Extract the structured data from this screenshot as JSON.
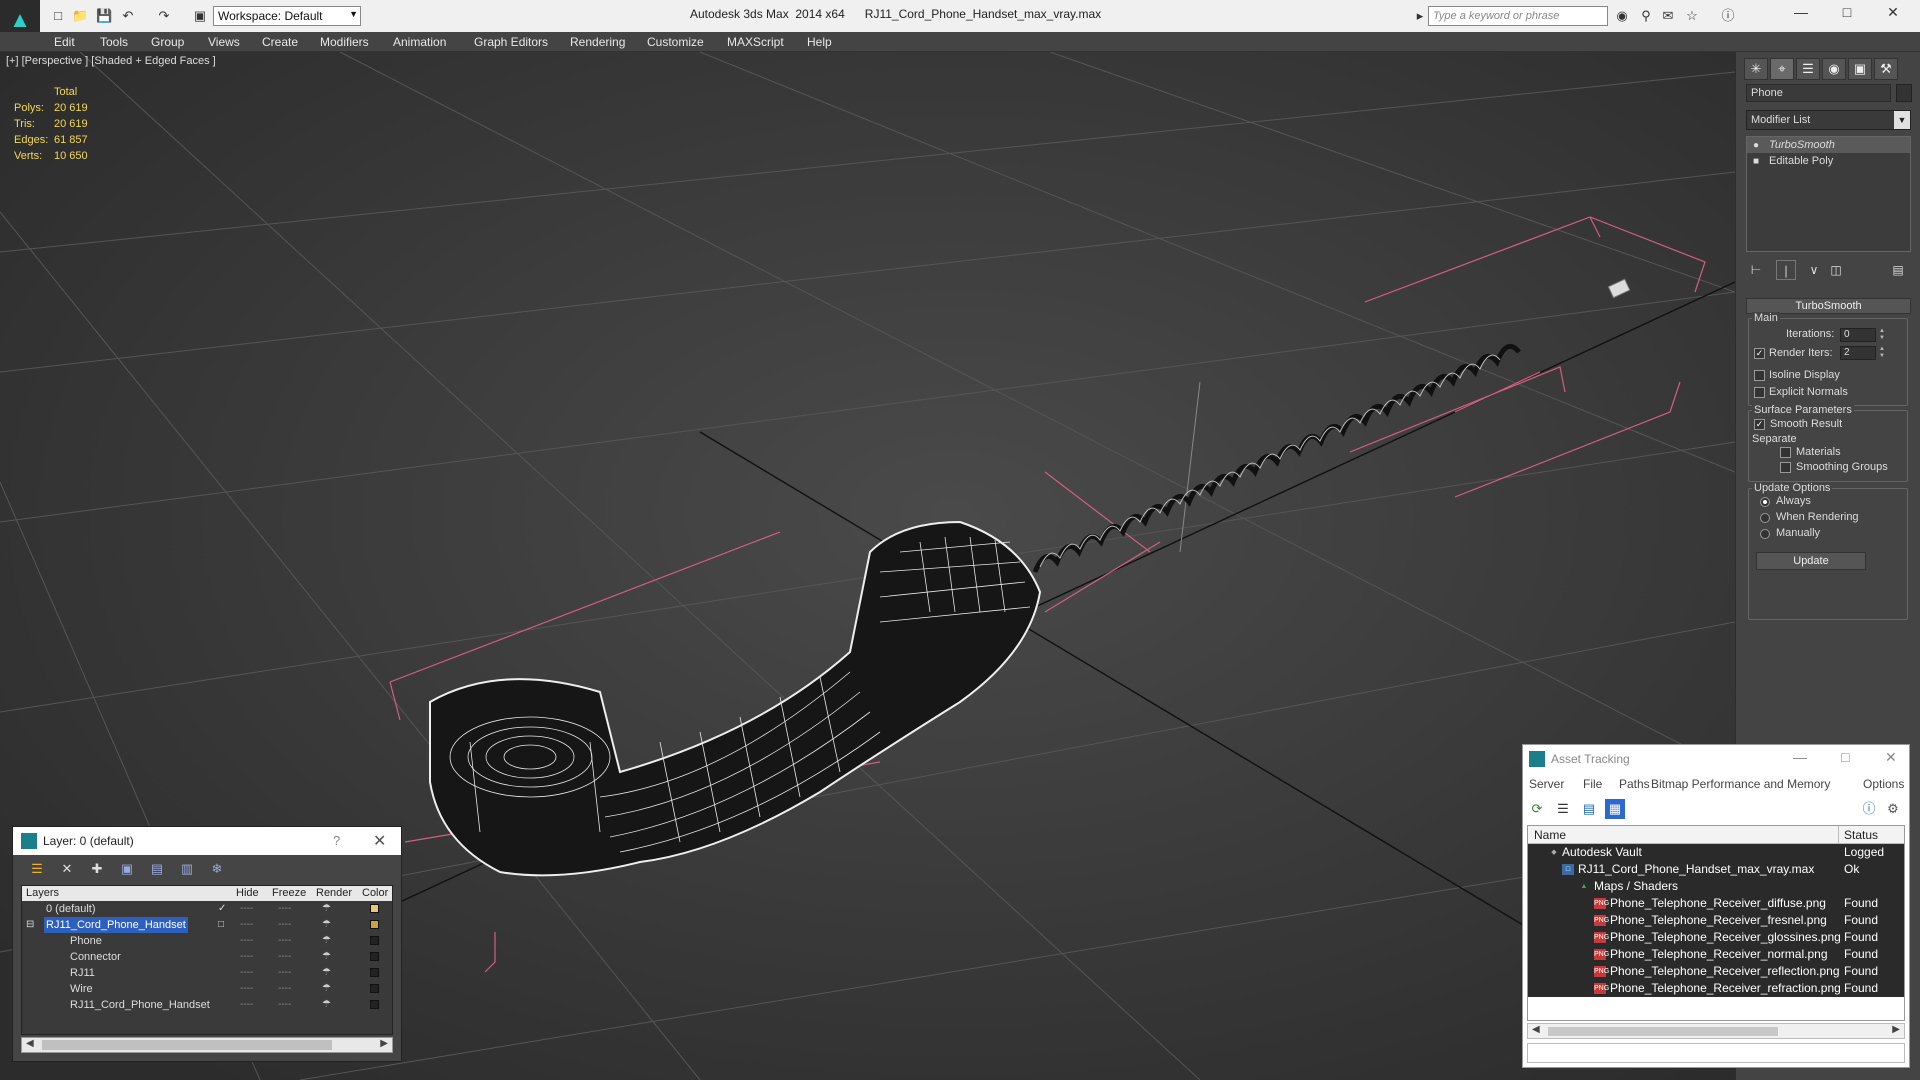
{
  "titlebar": {
    "workspace": "Workspace: Default",
    "app_name": "Autodesk 3ds Max  2014 x64",
    "file_name": "RJ11_Cord_Phone_Handset_max_vray.max",
    "search_placeholder": "Type a keyword or phrase"
  },
  "menu": [
    "Edit",
    "Tools",
    "Group",
    "Views",
    "Create",
    "Modifiers",
    "Animation",
    "Graph Editors",
    "Rendering",
    "Customize",
    "MAXScript",
    "Help"
  ],
  "viewport": {
    "label": "[+] [Perspective ] [Shaded + Edged Faces ]",
    "stats": {
      "header": "Total",
      "rows": [
        {
          "label": "Polys:",
          "value": "20 619"
        },
        {
          "label": "Tris:",
          "value": "20 619"
        },
        {
          "label": "Edges:",
          "value": "61 857"
        },
        {
          "label": "Verts:",
          "value": "10 650"
        }
      ]
    }
  },
  "command_panel": {
    "object_name": "Phone",
    "modifier_list": "Modifier List",
    "stack": [
      "TurboSmooth",
      "Editable Poly"
    ],
    "rollout": "TurboSmooth",
    "main_group": "Main",
    "iterations_label": "Iterations:",
    "iterations_value": "0",
    "render_iters_label": "Render Iters:",
    "render_iters_value": "2",
    "isoline": "Isoline Display",
    "explicit_normals": "Explicit Normals",
    "surface_group": "Surface Parameters",
    "smooth_result": "Smooth Result",
    "separate": "Separate",
    "materials": "Materials",
    "smoothing_groups": "Smoothing Groups",
    "update_group": "Update Options",
    "always": "Always",
    "when_rendering": "When Rendering",
    "manually": "Manually",
    "update_button": "Update"
  },
  "layer_dialog": {
    "title": "Layer: 0 (default)",
    "help": "?",
    "columns": [
      "Layers",
      "Hide",
      "Freeze",
      "Render",
      "Color"
    ],
    "rows": [
      {
        "name": "0 (default)",
        "indent": 0,
        "color": "#e8c77a"
      },
      {
        "name": "RJ11_Cord_Phone_Handset",
        "indent": 0,
        "color": "#c9a542"
      },
      {
        "name": "Phone",
        "indent": 1,
        "color": "#222222"
      },
      {
        "name": "Connector",
        "indent": 1,
        "color": "#222222"
      },
      {
        "name": "RJ11",
        "indent": 1,
        "color": "#222222"
      },
      {
        "name": "Wire",
        "indent": 1,
        "color": "#222222"
      },
      {
        "name": "RJ11_Cord_Phone_Handset",
        "indent": 1,
        "color": "#222222"
      }
    ],
    "cell_mark": "----"
  },
  "asset_dialog": {
    "title": "Asset Tracking",
    "menu": [
      "Server",
      "File",
      "Paths",
      "Bitmap Performance and Memory",
      "Options"
    ],
    "col_name": "Name",
    "col_status": "Status",
    "rows": [
      {
        "name": "Autodesk Vault",
        "status": "Logged Out",
        "indent": 0,
        "icon": "vault"
      },
      {
        "name": "RJ11_Cord_Phone_Handset_max_vray.max",
        "status": "Ok",
        "indent": 1,
        "icon": "max"
      },
      {
        "name": "Maps / Shaders",
        "status": "",
        "indent": 2,
        "icon": "maps"
      },
      {
        "name": "Phone_Telephone_Receiver_diffuse.png",
        "status": "Found",
        "indent": 3,
        "icon": "png"
      },
      {
        "name": "Phone_Telephone_Receiver_fresnel.png",
        "status": "Found",
        "indent": 3,
        "icon": "png"
      },
      {
        "name": "Phone_Telephone_Receiver_glossines.png",
        "status": "Found",
        "indent": 3,
        "icon": "png"
      },
      {
        "name": "Phone_Telephone_Receiver_normal.png",
        "status": "Found",
        "indent": 3,
        "icon": "png"
      },
      {
        "name": "Phone_Telephone_Receiver_reflection.png",
        "status": "Found",
        "indent": 3,
        "icon": "png"
      },
      {
        "name": "Phone_Telephone_Receiver_refraction.png",
        "status": "Found",
        "indent": 3,
        "icon": "png"
      }
    ]
  },
  "icons": {
    "app": "3ds-max-logo-icon",
    "png_badge": "PNG"
  }
}
